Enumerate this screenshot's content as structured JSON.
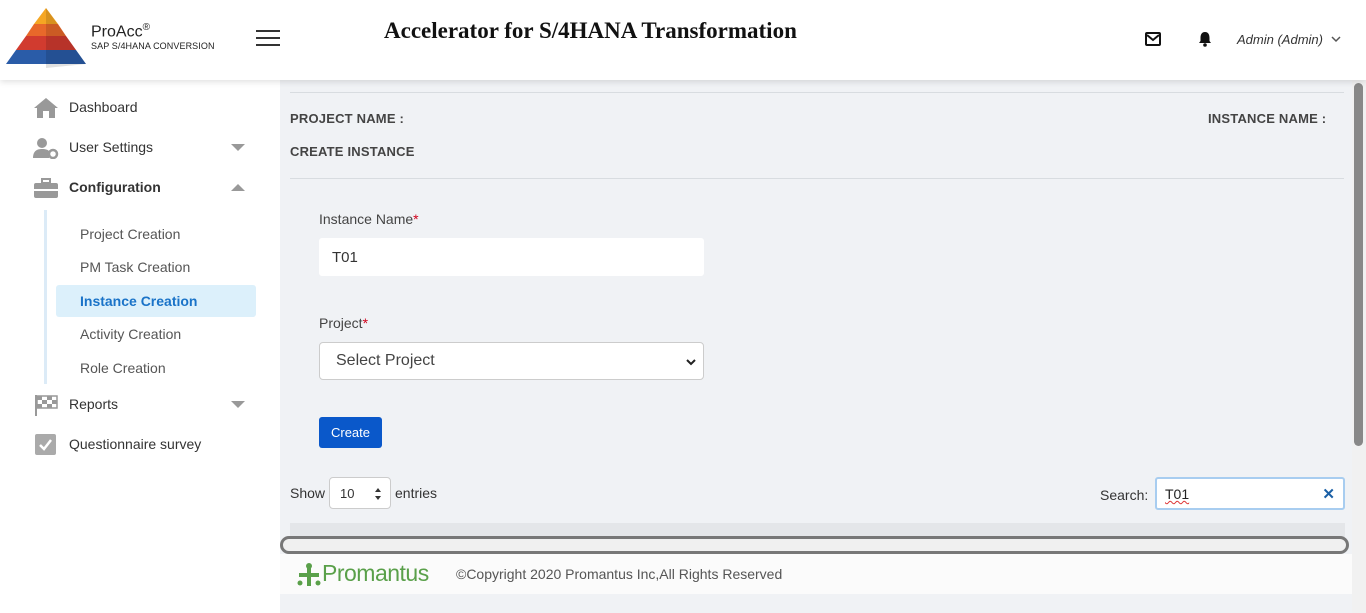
{
  "header": {
    "brand_name": "ProAcc",
    "brand_reg": "®",
    "brand_sub": "SAP S/4HANA CONVERSION",
    "app_title": "Accelerator for S/4HANA Transformation",
    "user": "Admin (Admin)"
  },
  "sidebar": {
    "items": [
      {
        "label": "Dashboard",
        "icon": "home-icon"
      },
      {
        "label": "User Settings",
        "icon": "user-gear-icon"
      },
      {
        "label": "Configuration",
        "icon": "briefcase-icon"
      },
      {
        "label": "Reports",
        "icon": "checkered-flag-icon"
      },
      {
        "label": "Questionnaire survey",
        "icon": "checkbox-icon"
      }
    ],
    "sub_items": [
      {
        "label": "Project Creation"
      },
      {
        "label": "PM Task Creation"
      },
      {
        "label": "Instance Creation",
        "active": true
      },
      {
        "label": "Activity Creation"
      },
      {
        "label": "Role Creation"
      }
    ]
  },
  "main": {
    "project_name_label": "PROJECT NAME :",
    "instance_name_label": "INSTANCE NAME :",
    "section_title": "CREATE INSTANCE",
    "instance_field_label": "Instance Name",
    "instance_field_value": "T01",
    "project_field_label": "Project",
    "project_select_value": "Select Project",
    "required_mark": "*",
    "create_button": "Create",
    "show_label": "Show",
    "entries_value": "10",
    "entries_label": "entries",
    "search_label": "Search:",
    "search_value": "T01"
  },
  "footer": {
    "brand": "Promantus",
    "copyright": "©Copyright 2020 Promantus Inc,All Rights Reserved"
  },
  "colors": {
    "primary": "#0a58ca",
    "active_bg": "#dcf0fb",
    "active_text": "#1a73c8",
    "footer_brand": "#5aa04a"
  }
}
